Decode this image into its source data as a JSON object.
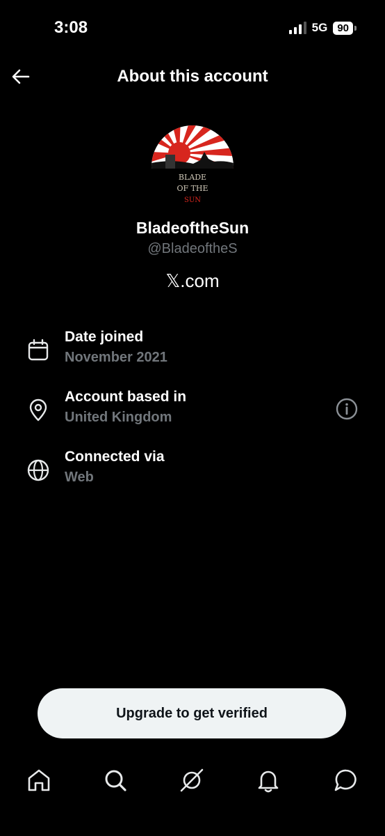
{
  "status_bar": {
    "time": "3:08",
    "network": "5G",
    "battery": "90"
  },
  "header": {
    "title": "About this account"
  },
  "profile": {
    "display_name": "BladeoftheSun",
    "handle": "@BladeoftheS",
    "site": "𝕏.com",
    "avatar_text_line1": "BLADE",
    "avatar_text_line2": "OF THE",
    "avatar_text_line3": "SUN"
  },
  "info": {
    "date_joined": {
      "label": "Date joined",
      "value": "November 2021"
    },
    "based_in": {
      "label": "Account based in",
      "value": "United Kingdom"
    },
    "connected": {
      "label": "Connected via",
      "value": "Web"
    }
  },
  "upgrade": {
    "label": "Upgrade to get verified"
  },
  "nav": [
    "home-icon",
    "search-icon",
    "grok-icon",
    "notifications-icon",
    "messages-icon"
  ],
  "colors": {
    "background": "#000000",
    "secondary_text": "#71767b",
    "button_bg": "#eff3f4",
    "avatar_red": "#d7261e"
  }
}
